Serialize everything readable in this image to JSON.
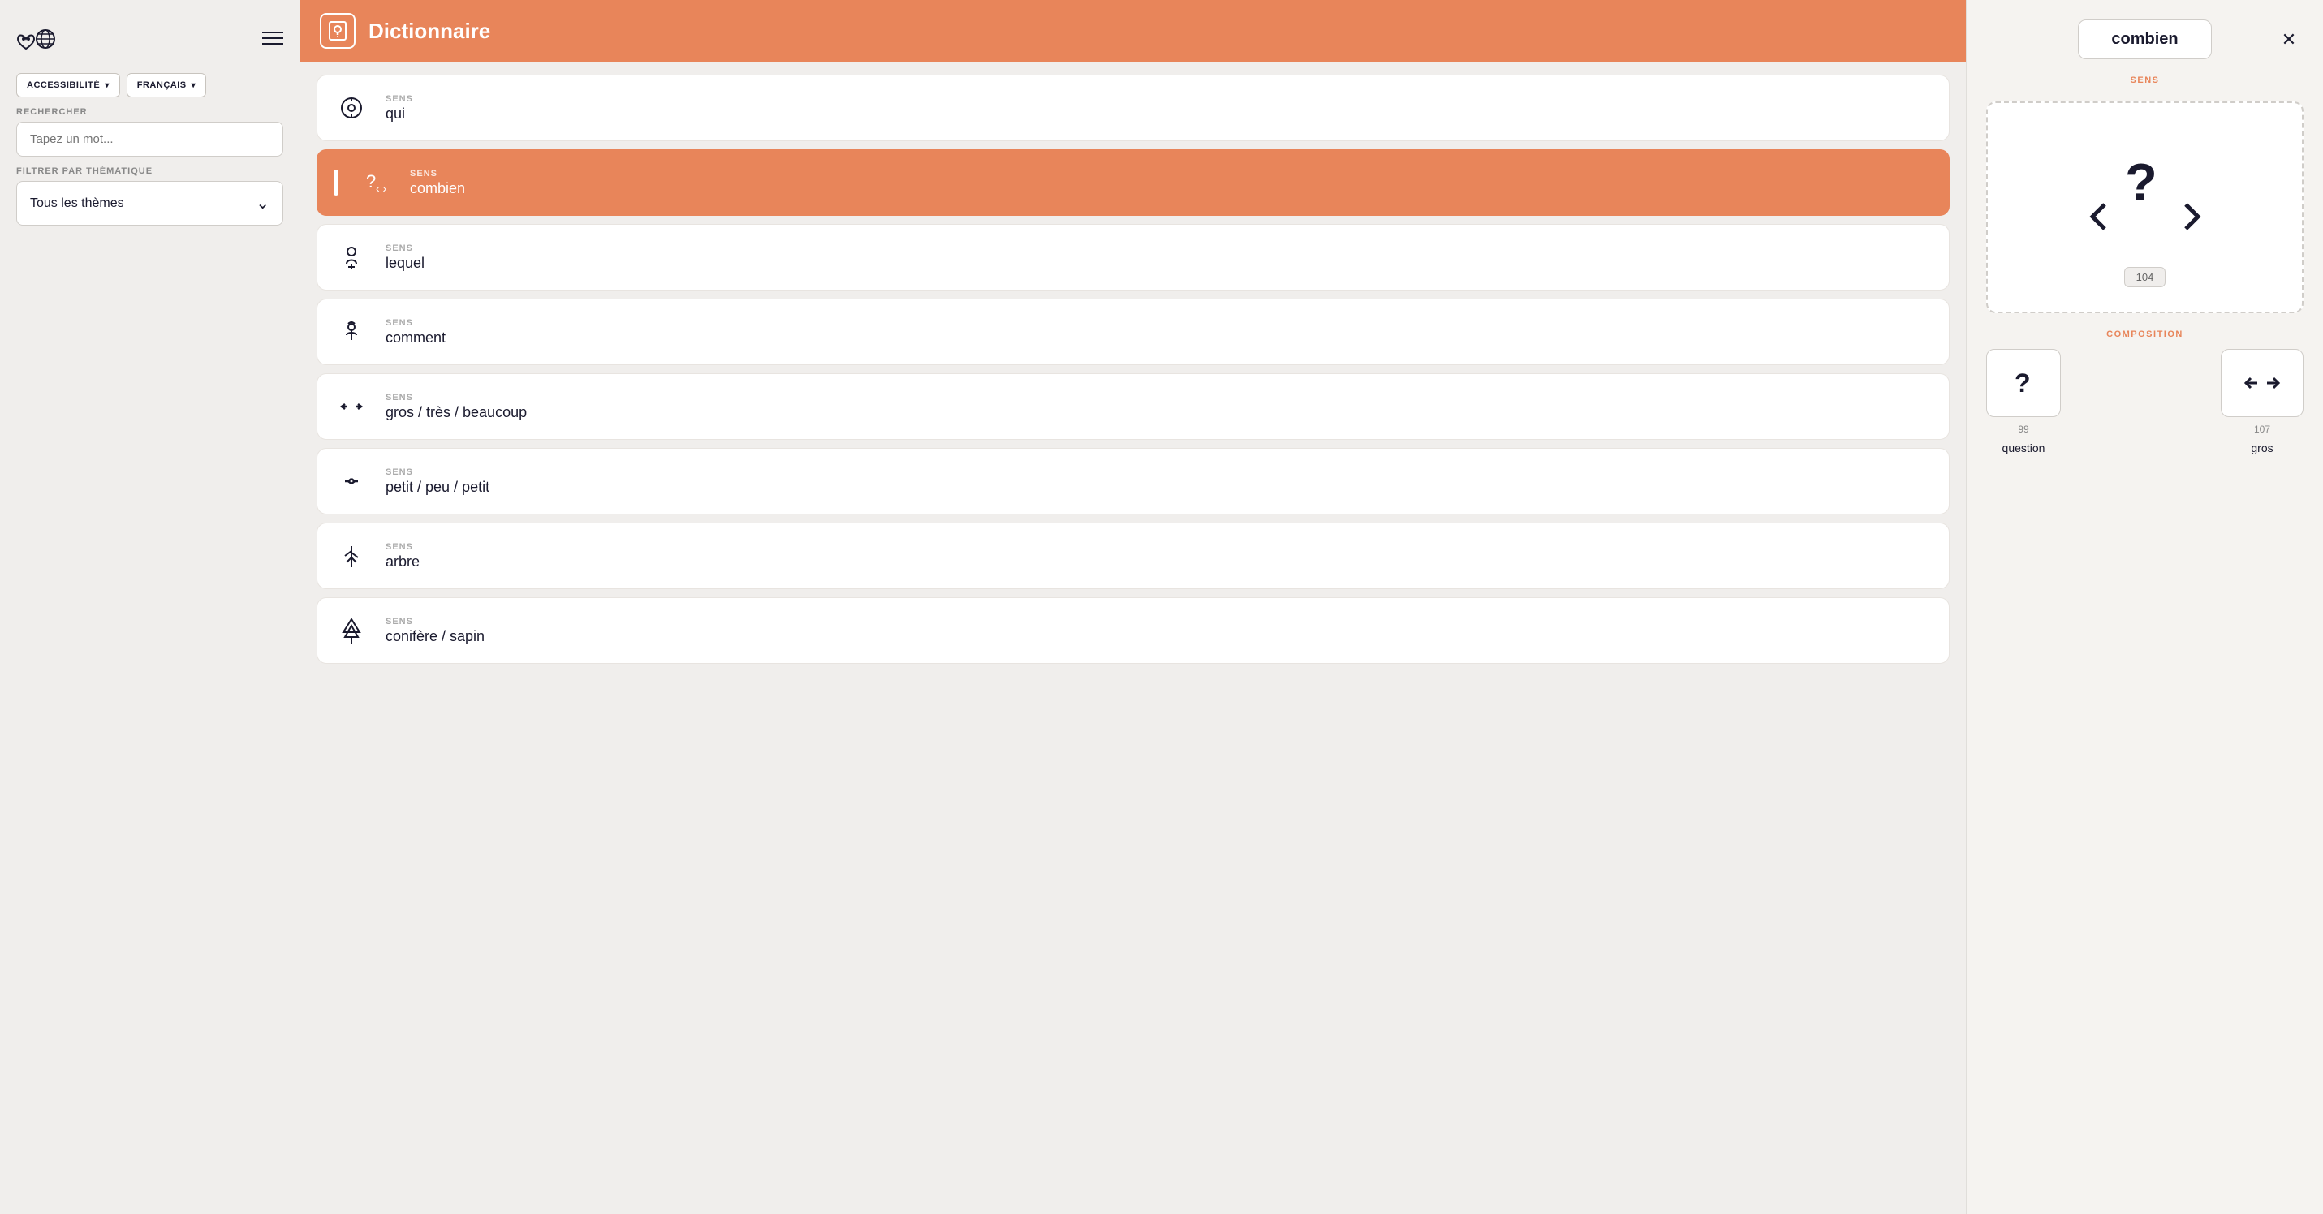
{
  "sidebar": {
    "accessibility_label": "ACCESSIBILITÉ",
    "language_label": "FRANÇAIS",
    "search_section_label": "RECHERCHER",
    "search_placeholder": "Tapez un mot...",
    "filter_label": "FILTRER PAR THÉMATIQUE",
    "filter_value": "Tous les thèmes"
  },
  "header": {
    "title": "Dictionnaire"
  },
  "words": [
    {
      "id": "qui",
      "label": "SENS",
      "word": "qui",
      "active": false
    },
    {
      "id": "combien",
      "label": "SENS",
      "word": "combien",
      "active": true
    },
    {
      "id": "lequel",
      "label": "SENS",
      "word": "lequel",
      "active": false
    },
    {
      "id": "comment",
      "label": "SENS",
      "word": "comment",
      "active": false
    },
    {
      "id": "gros",
      "label": "SENS",
      "word": "gros / très / beaucoup",
      "active": false
    },
    {
      "id": "petit",
      "label": "SENS",
      "word": "petit / peu / petit",
      "active": false
    },
    {
      "id": "arbre",
      "label": "SENS",
      "word": "arbre",
      "active": false
    },
    {
      "id": "conifere",
      "label": "SENS",
      "word": "conifère / sapin",
      "active": false
    }
  ],
  "detail": {
    "title": "combien",
    "sens_label": "SENS",
    "sign_number": "104",
    "composition_label": "COMPOSITION",
    "components": [
      {
        "number": "99",
        "word": "question"
      },
      {
        "number": "107",
        "word": "gros"
      }
    ]
  },
  "colors": {
    "orange": "#E8855A",
    "navy": "#1a1a2e"
  }
}
